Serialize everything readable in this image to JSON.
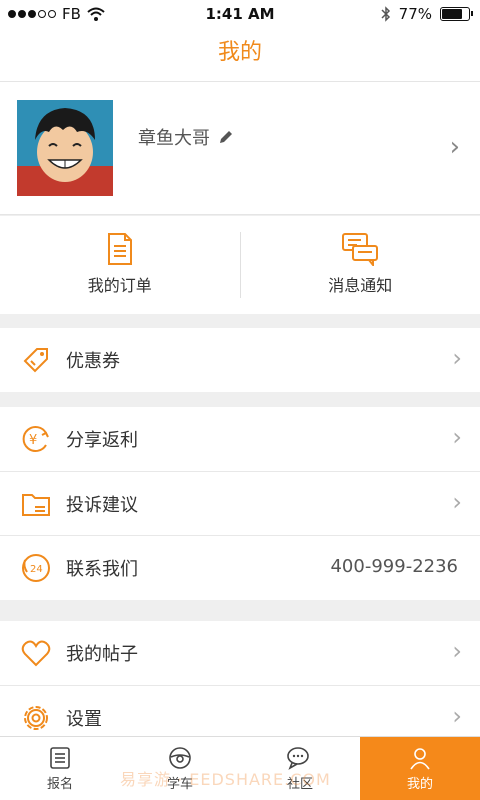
{
  "status_bar": {
    "carrier": "FB",
    "time": "1:41 AM",
    "battery": "77%"
  },
  "header": {
    "title": "我的"
  },
  "profile": {
    "username": "章鱼大哥"
  },
  "quick_actions": [
    {
      "label": "我的订单",
      "icon": "document-icon"
    },
    {
      "label": "消息通知",
      "icon": "chat-bubbles-icon"
    }
  ],
  "menu": {
    "coupons": "优惠券",
    "share_rebate": "分享返利",
    "complaints": "投诉建议",
    "contact": "联系我们",
    "contact_phone": "400-999-2236",
    "my_posts": "我的帖子",
    "settings": "设置"
  },
  "tabs": [
    {
      "label": "报名",
      "icon": "list-icon",
      "active": false
    },
    {
      "label": "学车",
      "icon": "steering-wheel-icon",
      "active": false
    },
    {
      "label": "社区",
      "icon": "chat-icon",
      "active": false
    },
    {
      "label": "我的",
      "icon": "person-icon",
      "active": true
    }
  ],
  "watermark": "易享游 · EEDSHARE.COM",
  "colors": {
    "accent": "#f08a1c",
    "tab_active_bg": "#f5891a"
  }
}
